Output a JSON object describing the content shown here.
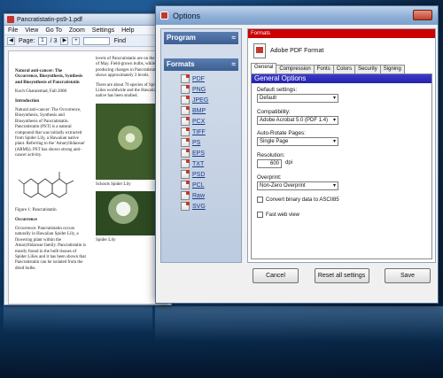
{
  "viewer": {
    "title": "Pancratistatin-ps9-1.pdf",
    "menu": [
      "File",
      "View",
      "Go To",
      "Zoom",
      "Settings",
      "Help"
    ],
    "page_label": "Page:",
    "page_current": "1",
    "page_of": "/ 3",
    "find_label": "Find",
    "doc": {
      "heading": "Natural anti-cancer: The Occurrence, Biosynthesis, Synthesis and Biosynthesis of Pancratistatin",
      "author": "Koch Gharaiemad, Fall 2008",
      "intro_head": "Introduction",
      "intro": "Natural anti-cancer: The Occurrence, Biosynthesis, Synthesis and Biosynthesis of Pancratistatin. Pancratistatin (PST) is a natural compound that was initially extracted from Spider Lily, a Hawaiian native plant. Referring to the 'Amaryllidaceae' (ARMS). PST has shown strong anti-cancer activity.",
      "fig_caption": "Figure 1: Pancratistatin",
      "occ_head": "Occurrence",
      "occ": "Occurrence: Pancratistatin occurs naturally in Hawaiian Spider Lily, a flowering plant within the Amaryllidaceae family. Pancratistatin is mostly found in the bulb tissues of Spider Lilies and it has been shown that Pancratistatin can be isolated from the dried bulbs.",
      "col2_top": "levels of Pancratistatin are on the order of May. Field-grown bulbs, while producing changes in Pancratistatin, shows approximately 3 levels.",
      "col2_mid": "There are about 70 species of Spider Lilies worldwide and the Hawaiian native has been studied.",
      "photo_caption": "Schools Spider Lily",
      "photo2_caption": "Spider Lily"
    }
  },
  "dialog": {
    "title": "Options",
    "sidebar": {
      "program_label": "Program",
      "formats_label": "Formats",
      "items": [
        "PDF",
        "PNG",
        "JPEG",
        "BMP",
        "PCX",
        "TIFF",
        "PS",
        "EPS",
        "TXT",
        "PSD",
        "PCL",
        "Raw",
        "SVG"
      ]
    },
    "main": {
      "header": "Formats",
      "format_name": "Adobe PDF Format",
      "tabs": [
        "General",
        "Compression",
        "Fonts",
        "Colors",
        "Security",
        "Signing"
      ],
      "section": "General Options",
      "default_settings_label": "Default settings:",
      "default_settings_value": "Default",
      "compat_label": "Compatibility:",
      "compat_value": "Adobe Acrobat 5.0 (PDF 1.4)",
      "autorotate_label": "Auto-Rotate Pages:",
      "autorotate_value": "Single Page",
      "resolution_label": "Resolution:",
      "resolution_value": "600",
      "resolution_unit": "dpi",
      "overprint_label": "Overprint:",
      "overprint_value": "Non-Zero Overprint",
      "convert_label": "Convert binary data to ASCII85",
      "fastweb_label": "Fast web view"
    },
    "buttons": {
      "cancel": "Cancel",
      "reset": "Reset all settings",
      "save": "Save"
    }
  },
  "colors": {
    "accent": "#c00000",
    "section": "#2b2bbf",
    "background": "#17497e"
  }
}
